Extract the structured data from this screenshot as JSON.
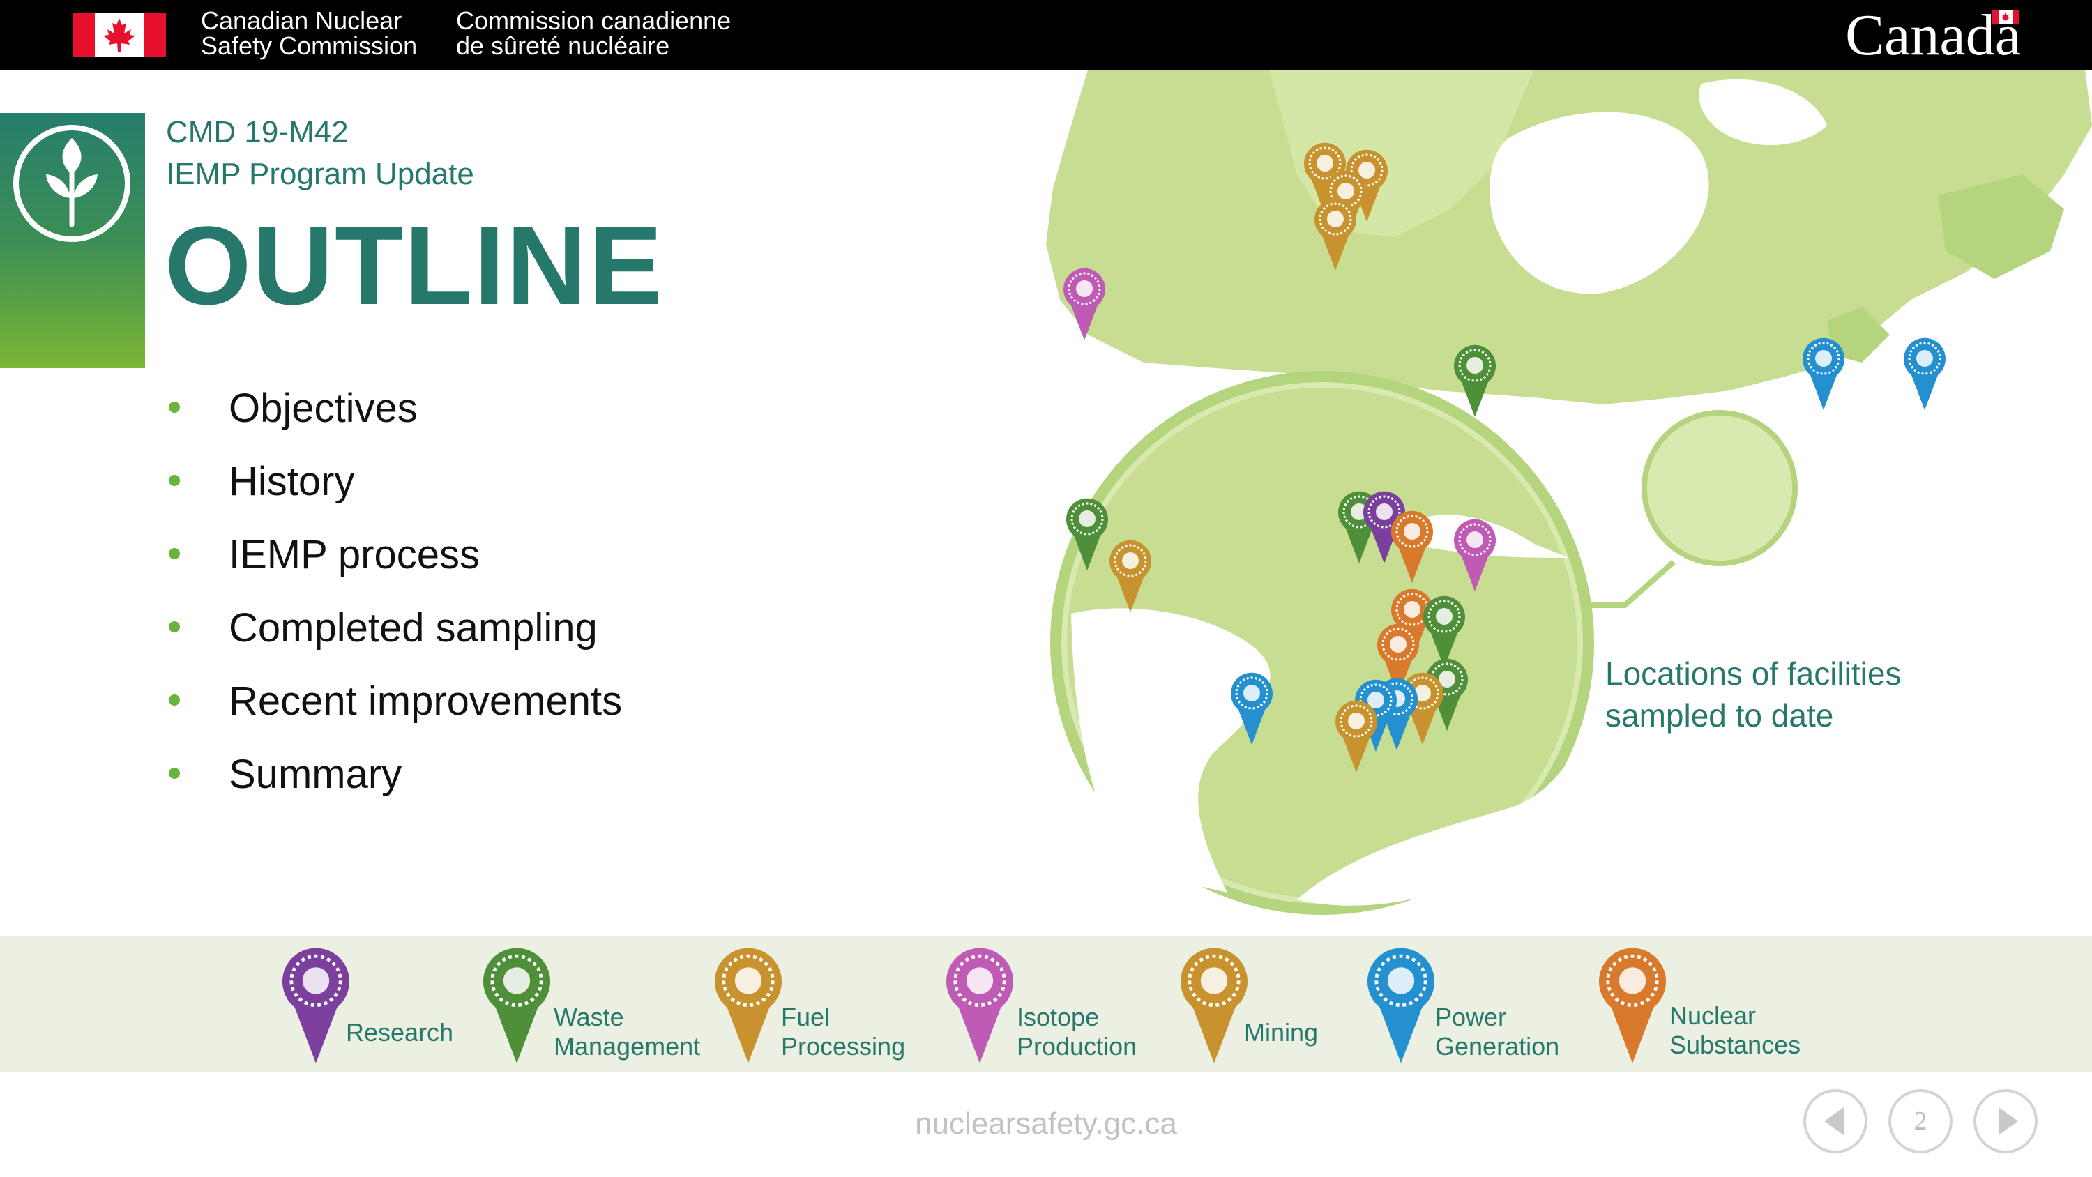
{
  "header": {
    "dept_en_line1": "Canadian Nuclear",
    "dept_en_line2": "Safety Commission",
    "dept_fr_line1": "Commission canadienne",
    "dept_fr_line2": "de sûreté nucléaire",
    "wordmark": "Canada"
  },
  "slide": {
    "cmd": "CMD 19-M42",
    "subtitle": "IEMP Program Update",
    "title": "OUTLINE",
    "bullets": [
      "Objectives",
      "History",
      "IEMP process",
      "Completed sampling",
      "Recent improvements",
      "Summary"
    ],
    "map_caption_line1": "Locations of facilities",
    "map_caption_line2": "sampled to date"
  },
  "legend": [
    {
      "line1": "Research",
      "line2": "",
      "color": "#7b3f9e",
      "icon": "microscope-icon"
    },
    {
      "line1": "Waste",
      "line2": "Management",
      "color": "#4f8f3a",
      "icon": "waste-container-icon"
    },
    {
      "line1": "Fuel",
      "line2": "Processing",
      "color": "#c8932e",
      "icon": "fuel-bundle-icon"
    },
    {
      "line1": "Isotope",
      "line2": "Production",
      "color": "#c05bb5",
      "icon": "caduceus-icon"
    },
    {
      "line1": "Mining",
      "line2": "",
      "color": "#c8932e",
      "icon": "mine-cart-icon"
    },
    {
      "line1": "Power",
      "line2": "Generation",
      "color": "#2490d0",
      "icon": "lightning-icon"
    },
    {
      "line1": "Nuclear",
      "line2": "Substances",
      "color": "#d9792c",
      "icon": "gauge-device-icon"
    }
  ],
  "footer": {
    "url": "nuclearsafety.gc.ca",
    "page_number": "2"
  },
  "colors": {
    "brand_teal": "#26786a",
    "bullet_green": "#6ab43e",
    "map_land": "#c6dd92",
    "legend_bg": "#ebf0e2"
  }
}
